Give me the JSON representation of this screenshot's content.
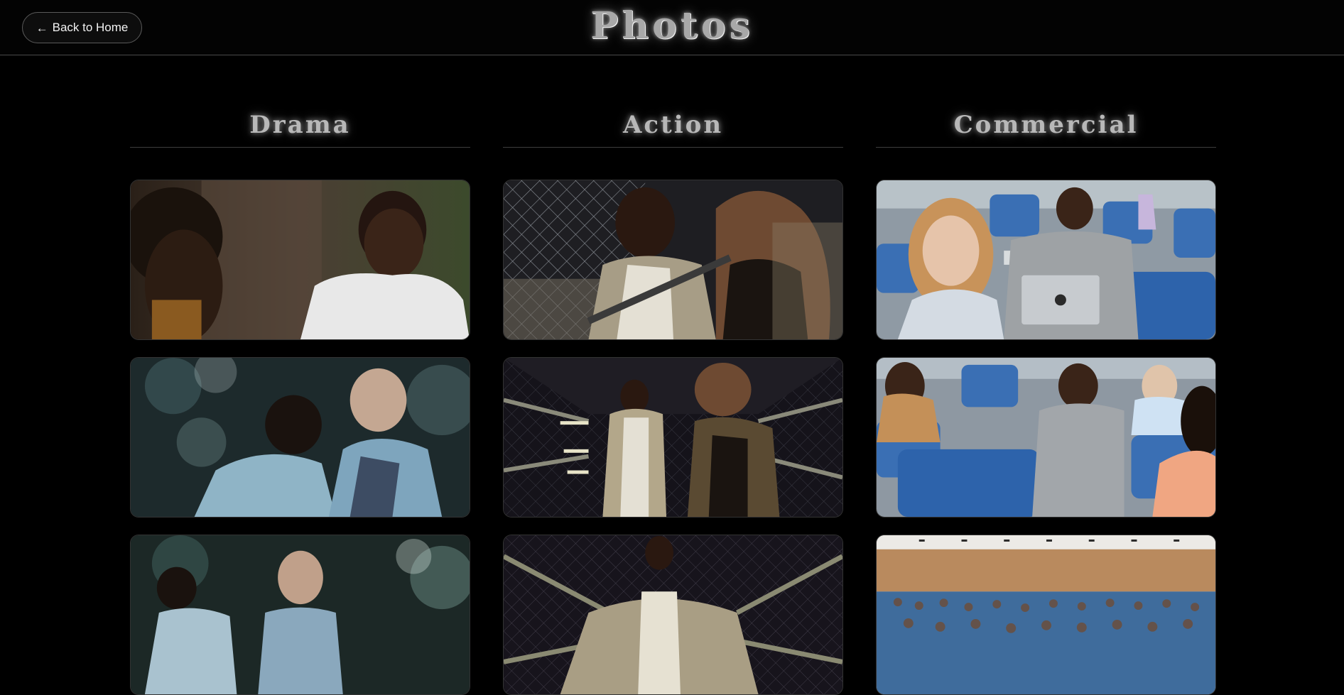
{
  "header": {
    "back_label": "Back to Home",
    "title": "Photos"
  },
  "columns": [
    {
      "title": "Drama"
    },
    {
      "title": "Action"
    },
    {
      "title": "Commercial"
    }
  ]
}
